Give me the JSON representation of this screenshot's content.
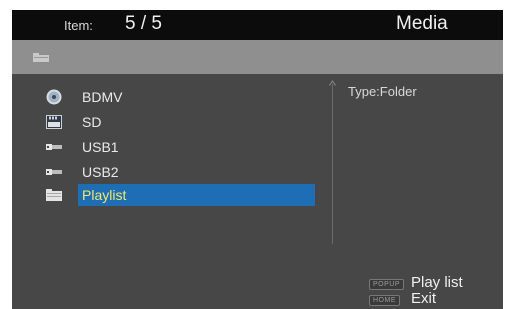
{
  "header": {
    "item_label": "Item:",
    "item_count": "5 / 5",
    "title": "Media"
  },
  "path_bar": {
    "icon": "folder-icon"
  },
  "file_list": {
    "items": [
      {
        "label": "BDMV",
        "icon": "disc-icon",
        "selected": false
      },
      {
        "label": "SD",
        "icon": "sd-card-icon",
        "selected": false
      },
      {
        "label": "USB1",
        "icon": "usb-icon",
        "selected": false
      },
      {
        "label": "USB2",
        "icon": "usb-icon",
        "selected": false
      },
      {
        "label": "Playlist",
        "icon": "folder-icon",
        "selected": true
      }
    ]
  },
  "info_panel": {
    "type_text": "Type:Folder"
  },
  "legend": {
    "items": [
      {
        "key": "POPUP",
        "action": "Play list"
      },
      {
        "key": "HOME",
        "action": "Exit"
      }
    ]
  },
  "colors": {
    "background": "#474747",
    "header": "#0c0c0c",
    "path_bar": "#8f8f8f",
    "selection": "#1e6eb6",
    "selected_text": "#f3e76a"
  }
}
